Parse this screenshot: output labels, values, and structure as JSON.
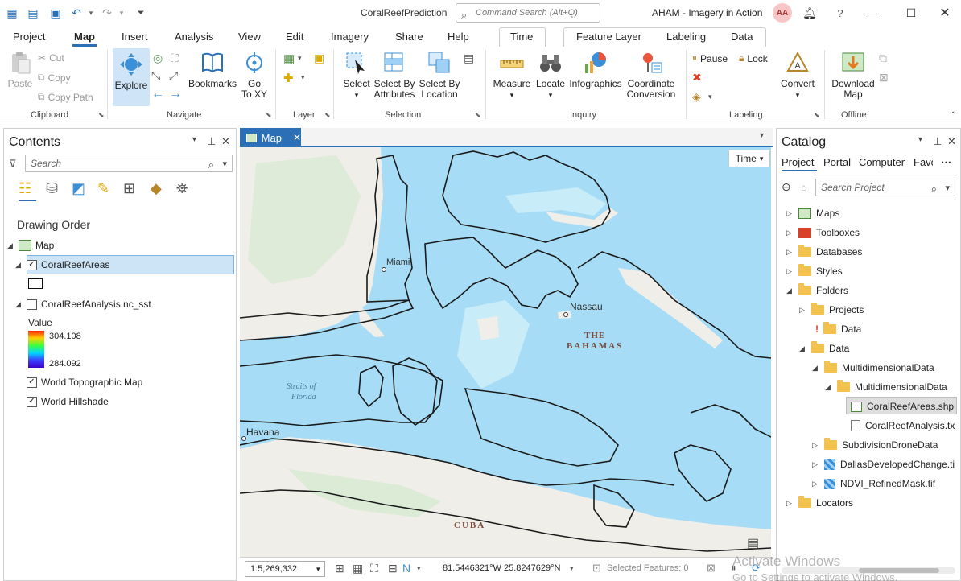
{
  "titlebar": {
    "project_name": "CoralReefPrediction",
    "command_search_placeholder": "Command Search (Alt+Q)",
    "user_name": "AHAM - Imagery in Action",
    "user_initials": "AA"
  },
  "ribbon_tabs": [
    "Project",
    "Map",
    "Insert",
    "Analysis",
    "View",
    "Edit",
    "Imagery",
    "Share",
    "Help",
    "Time",
    "Feature Layer",
    "Labeling",
    "Data"
  ],
  "active_tab": "Map",
  "ribbon": {
    "clipboard": {
      "label": "Clipboard",
      "paste": "Paste",
      "cut": "Cut",
      "copy": "Copy",
      "copy_path": "Copy Path"
    },
    "navigate": {
      "label": "Navigate",
      "explore": "Explore",
      "bookmarks": "Bookmarks",
      "goto_line1": "Go",
      "goto_line2": "To XY"
    },
    "layer": {
      "label": "Layer"
    },
    "selection": {
      "label": "Selection",
      "select": "Select",
      "by_attr_1": "Select By",
      "by_attr_2": "Attributes",
      "by_loc_1": "Select By",
      "by_loc_2": "Location"
    },
    "inquiry": {
      "label": "Inquiry",
      "measure": "Measure",
      "locate": "Locate",
      "infographics": "Infographics",
      "coord_1": "Coordinate",
      "coord_2": "Conversion"
    },
    "labeling": {
      "label": "Labeling",
      "pause": "Pause",
      "lock": "Lock",
      "convert": "Convert"
    },
    "offline": {
      "label": "Offline",
      "download_1": "Download",
      "download_2": "Map"
    }
  },
  "contents": {
    "title": "Contents",
    "search_placeholder": "Search",
    "drawing_order": "Drawing Order",
    "map_name": "Map",
    "layers": [
      {
        "name": "CoralReefAreas",
        "checked": true,
        "selected": true
      },
      {
        "name": "CoralReefAnalysis.nc_sst",
        "checked": false
      },
      {
        "name": "World Topographic Map",
        "checked": true
      },
      {
        "name": "World Hillshade",
        "checked": true
      }
    ],
    "legend": {
      "title": "Value",
      "high": "304.108",
      "low": "284.092"
    }
  },
  "map": {
    "tab_label": "Map",
    "time_button": "Time",
    "labels": {
      "miami": "Miami",
      "nassau": "Nassau",
      "bahamas_1": "THE",
      "bahamas_2": "BAHAMAS",
      "straits_1": "Straits of",
      "straits_2": "Florida",
      "havana": "Havana",
      "cuba": "CUBA"
    },
    "colors": {
      "water": "#a6dcf5",
      "land": "#efeee9",
      "land_green": "#d6ead0",
      "outline": "#1a1a1a"
    }
  },
  "statusbar": {
    "scale": "1:5,269,332",
    "coordinates": "81.5446321°W 25.8247629°N",
    "selected_features": "Selected Features: 0"
  },
  "catalog": {
    "title": "Catalog",
    "tabs": [
      "Project",
      "Portal",
      "Computer",
      "Favo"
    ],
    "active_tab": "Project",
    "search_placeholder": "Search Project",
    "items": {
      "maps": "Maps",
      "toolboxes": "Toolboxes",
      "databases": "Databases",
      "styles": "Styles",
      "folders": "Folders",
      "projects": "Projects",
      "projects_data": "Data",
      "data": "Data",
      "multidim": "MultidimensionalData",
      "multidim_inner": "MultidimensionalData",
      "coralreef_shp": "CoralReefAreas.shp",
      "coralreef_txt": "CoralReefAnalysis.tx",
      "subdivision": "SubdivisionDroneData",
      "dallas": "DallasDevelopedChange.ti",
      "ndvi": "NDVI_RefinedMask.tif",
      "locators": "Locators"
    }
  },
  "watermark": {
    "line1": "Activate Windows",
    "line2": "Go to Settings to activate Windows."
  }
}
